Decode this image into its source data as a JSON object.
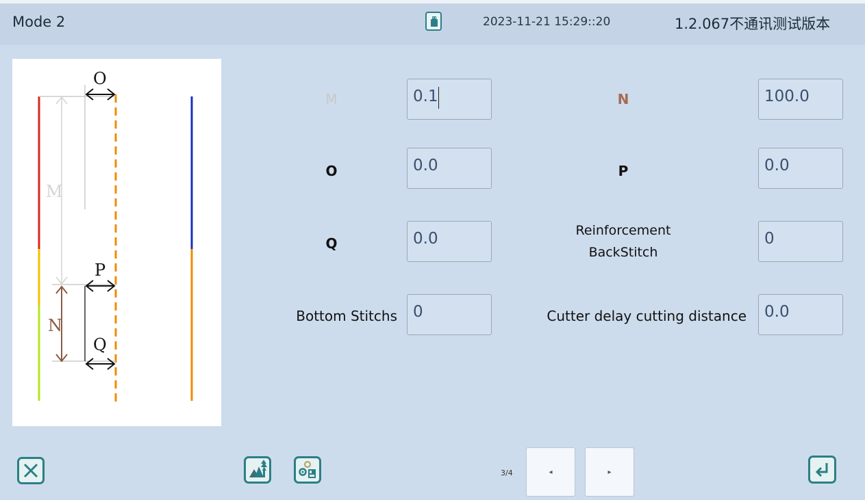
{
  "header": {
    "title": "Mode 2",
    "datetime": "2023-11-21 15:29::20",
    "version": "1.2.067不通讯测试版本",
    "usb_icon": "usb-drive-icon"
  },
  "diagram": {
    "labels": [
      "O",
      "M",
      "P",
      "N",
      "Q"
    ],
    "colors": {
      "red": "#d9281e",
      "yellow": "#f2c200",
      "lime": "#b5e61d",
      "blue": "#1a2fb8",
      "orange": "#f08c00",
      "brown": "#8b5a44",
      "gray": "#cccccc"
    }
  },
  "form": {
    "m_label": "M",
    "m_value": "0.1",
    "n_label": "N",
    "n_value": "100.0",
    "o_label": "O",
    "o_value": "0.0",
    "p_label": "P",
    "p_value": "0.0",
    "q_label": "Q",
    "q_value": "0.0",
    "reinforcement_label_1": "Reinforcement",
    "reinforcement_label_2": "BackStitch",
    "reinforcement_value": "0",
    "bottom_label": "Bottom Stitchs",
    "bottom_value": "0",
    "cutter_label": "Cutter delay cutting distance",
    "cutter_value": "0.0"
  },
  "footer": {
    "page": "3/4",
    "prev": "◂",
    "next": "▸",
    "icons": [
      "close-icon",
      "pattern-icon",
      "machine-settings-icon",
      "enter-icon"
    ]
  },
  "colors": {
    "background": "#cddcec",
    "accent": "#2a7f86",
    "disabled": "#c8c8c8",
    "n_label": "#a86a52"
  }
}
